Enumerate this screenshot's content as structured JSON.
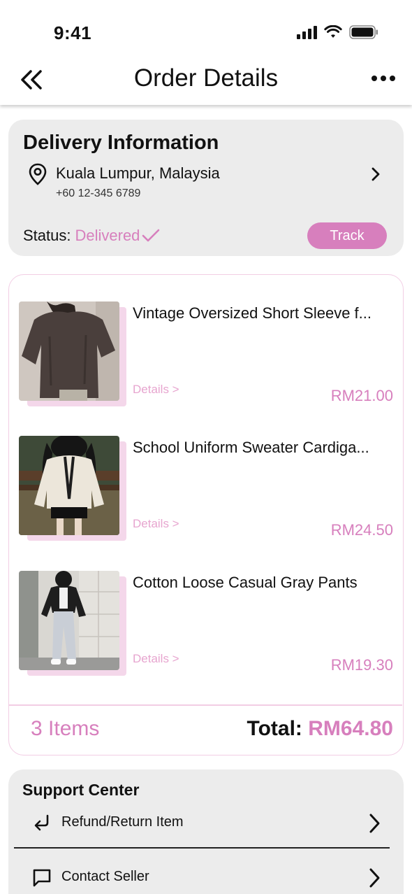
{
  "status_bar": {
    "time": "9:41"
  },
  "nav": {
    "title": "Order Details",
    "back_icon": "double-chevron-left-icon",
    "more_icon": "ellipsis-icon"
  },
  "delivery": {
    "title": "Delivery Information",
    "address": "Kuala Lumpur, Malaysia",
    "phone": "+60 12-345 6789",
    "status_label": "Status:",
    "status_value": "Delivered",
    "track_label": "Track"
  },
  "items": [
    {
      "name": "Vintage Oversized Short Sleeve f...",
      "details": "Details >",
      "price": "RM21.00"
    },
    {
      "name": "School Uniform Sweater Cardiga...",
      "details": "Details >",
      "price": "RM24.50"
    },
    {
      "name": "Cotton Loose Casual Gray Pants",
      "details": "Details >",
      "price": "RM19.30"
    }
  ],
  "summary": {
    "count": "3 Items",
    "total_label": "Total:",
    "total_value": "RM64.80"
  },
  "support": {
    "title": "Support Center",
    "refund_label": "Refund/Return Item",
    "contact_label": "Contact Seller"
  },
  "colors": {
    "accent": "#d77fbd",
    "accent_light": "#f4d7ea",
    "card_grey": "#ececec"
  }
}
